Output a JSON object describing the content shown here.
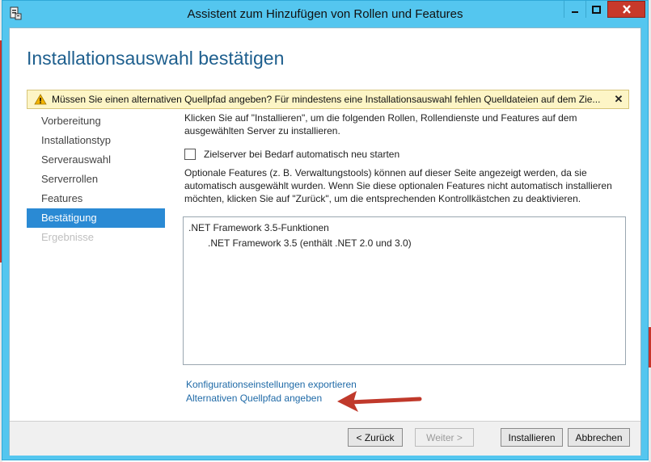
{
  "window": {
    "title": "Assistent zum Hinzufügen von Rollen und Features",
    "accent_color": "#54c6ef",
    "close_color": "#c7392b"
  },
  "page": {
    "title": "Installationsauswahl bestätigen"
  },
  "banner": {
    "icon": "warning-icon",
    "message": "Müssen Sie einen alternativen Quellpfad angeben? Für mindestens eine Installationsauswahl fehlen Quelldateien auf dem Zie...",
    "close": "✕"
  },
  "nav": {
    "items": [
      {
        "label": "Vorbereitung",
        "state": "normal"
      },
      {
        "label": "Installationstyp",
        "state": "normal"
      },
      {
        "label": "Serverauswahl",
        "state": "normal"
      },
      {
        "label": "Serverrollen",
        "state": "normal"
      },
      {
        "label": "Features",
        "state": "normal"
      },
      {
        "label": "Bestätigung",
        "state": "active"
      },
      {
        "label": "Ergebnisse",
        "state": "disabled"
      }
    ]
  },
  "content": {
    "intro": "Klicken Sie auf \"Installieren\", um die folgenden Rollen, Rollendienste und Features auf dem ausgewählten Server zu installieren.",
    "restart_checkbox": {
      "label": "Zielserver bei Bedarf automatisch neu starten",
      "checked": false
    },
    "optional_note": "Optionale Features (z. B. Verwaltungstools) können auf dieser Seite angezeigt werden, da sie automatisch ausgewählt wurden. Wenn Sie diese optionalen Features nicht automatisch installieren möchten, klicken Sie auf \"Zurück\", um die entsprechenden Kontrollkästchen zu deaktivieren.",
    "features": [
      {
        "label": ".NET Framework 3.5-Funktionen",
        "level": 0
      },
      {
        "label": ".NET Framework 3.5 (enthält .NET 2.0 und 3.0)",
        "level": 1
      }
    ],
    "links": {
      "export": "Konfigurationseinstellungen exportieren",
      "alt_source": "Alternativen Quellpfad angeben"
    }
  },
  "buttons": {
    "back": "< Zurück",
    "next": "Weiter >",
    "install": "Installieren",
    "cancel": "Abbrechen"
  }
}
